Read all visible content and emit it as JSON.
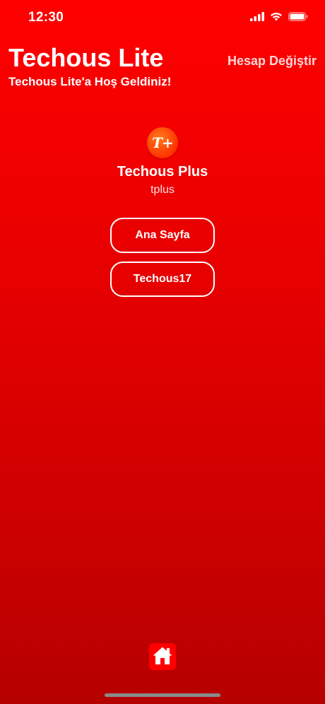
{
  "status_bar": {
    "time": "12:30",
    "icons": [
      "cellular-signal-icon",
      "wifi-icon",
      "battery-icon"
    ]
  },
  "header": {
    "title": "Techous Lite",
    "subtitle": "Techous Lite'a Hoş Geldiniz!",
    "switch_account_label": "Hesap Değiştir"
  },
  "profile": {
    "avatar_text": "T+",
    "name": "Techous Plus",
    "handle": "tplus"
  },
  "actions": [
    {
      "label": "Ana Sayfa"
    },
    {
      "label": "Techous17"
    }
  ],
  "bottom_bar": {
    "home_icon": "home-icon"
  },
  "colors": {
    "background_top": "#ff0000",
    "background_bottom": "#b50000",
    "text": "#ffffff",
    "switch_account": "#ffd6d6",
    "home_icon_bg": "#ff0000"
  }
}
